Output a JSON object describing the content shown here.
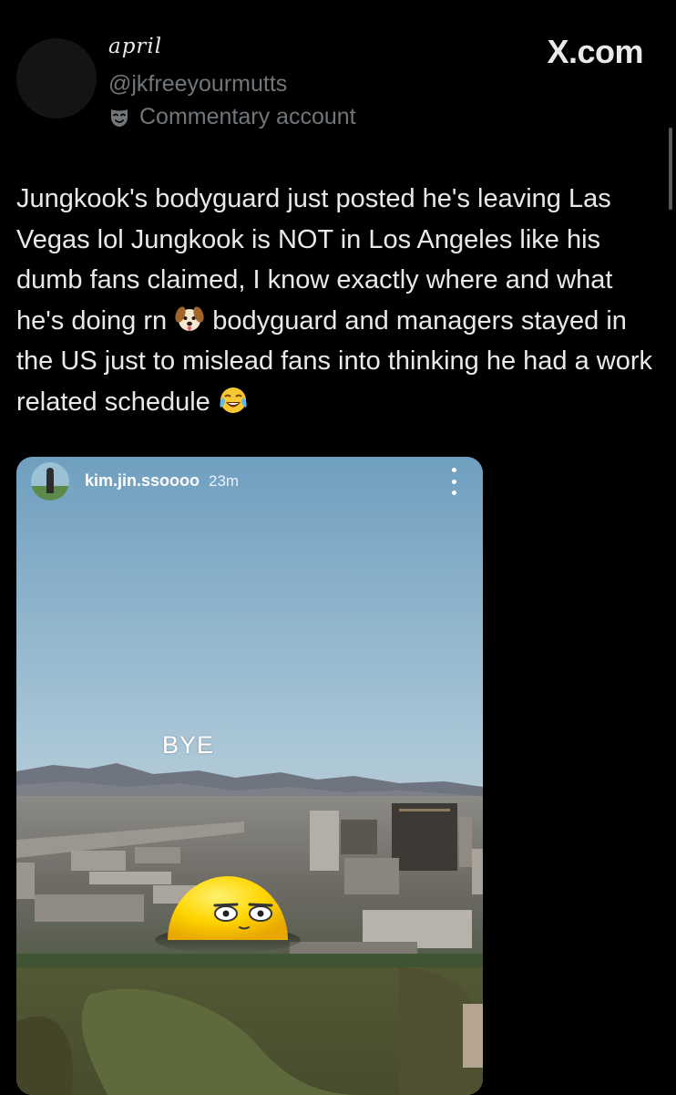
{
  "author": {
    "display_name": "april",
    "handle": "@jkfreeyourmutts",
    "label": "Commentary account",
    "label_icon": "theater-mask-icon"
  },
  "brand": "X.com",
  "tweet": {
    "text_part1": "Jungkook's bodyguard just posted he's leaving Las Vegas lol Jungkook is NOT in Los Angeles like his dumb fans claimed, I know exactly where and what he's doing rn ",
    "emoji1": "dog-face-emoji",
    "text_part2": " bodyguard and managers stayed in the US just to mislead fans into thinking he had a work related schedule ",
    "emoji2": "face-with-tears-of-joy-emoji"
  },
  "story": {
    "username": "kim.jin.ssoooo",
    "time": "23m",
    "overlay_text": "BYE",
    "sticker": "sphere-emoji-face"
  },
  "colors": {
    "background": "#000000",
    "primary_text": "#e7e9ea",
    "secondary_text": "#71767b",
    "sphere_yellow": "#ffd500"
  }
}
